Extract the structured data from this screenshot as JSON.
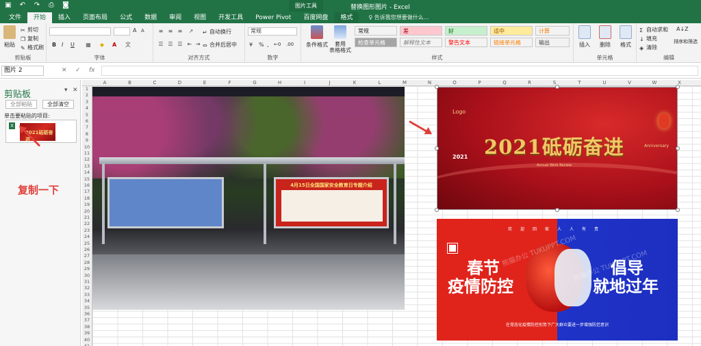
{
  "window": {
    "title": "替换图形图片 - Excel",
    "context_group": "图片工具",
    "qat_icons": [
      "save-icon",
      "undo-icon",
      "redo-icon",
      "print-preview-icon",
      "screenshot-icon"
    ]
  },
  "tabs": [
    "文件",
    "开始",
    "插入",
    "页面布局",
    "公式",
    "数据",
    "审阅",
    "视图",
    "开发工具",
    "Power Pivot",
    "百度网盘",
    "格式"
  ],
  "active_tab": "开始",
  "tell_me": "告诉我您想要做什么...",
  "ribbon": {
    "clipboard": {
      "label": "剪贴板",
      "paste": "粘贴",
      "cut": "剪切",
      "copy": "复制",
      "format_painter": "格式刷"
    },
    "font": {
      "label": "字体",
      "bold": "B",
      "italic": "I",
      "underline": "U",
      "grow": "A",
      "shrink": "A",
      "color_letter": "A"
    },
    "alignment": {
      "label": "对齐方式",
      "wrap": "自动换行",
      "merge": "合并后居中"
    },
    "number": {
      "label": "数字",
      "format": "常规",
      "pct": "%",
      "comma": ",",
      "inc": "←0",
      "dec": ".00"
    },
    "styles": {
      "label": "样式",
      "conditional": "条件格式",
      "table": "套用\n表格格式",
      "cells": [
        {
          "text": "常规",
          "bg": "#ffffff",
          "color": "#222222"
        },
        {
          "text": "差",
          "bg": "#ffc7ce",
          "color": "#9c0006"
        },
        {
          "text": "好",
          "bg": "#c6efce",
          "color": "#006100"
        },
        {
          "text": "适中",
          "bg": "#ffeb9c",
          "color": "#9c5700"
        },
        {
          "text": "计算",
          "bg": "#f2f2f2",
          "color": "#fa7d00"
        },
        {
          "text": "检查单元格",
          "bg": "#a5a5a5",
          "color": "#ffffff"
        },
        {
          "text": "解释性文本",
          "bg": "#ffffff",
          "color": "#7f7f7f"
        },
        {
          "text": "警告文本",
          "bg": "#ffffff",
          "color": "#ff0000"
        },
        {
          "text": "链接单元格",
          "bg": "#ffffff",
          "color": "#fa7d00"
        },
        {
          "text": "输出",
          "bg": "#f2f2f2",
          "color": "#3f3f3f"
        }
      ]
    },
    "cells": {
      "label": "单元格",
      "insert": "插入",
      "delete": "删除",
      "format": "格式"
    },
    "editing": {
      "label": "编辑",
      "autosum": "自动求和",
      "fill": "填充",
      "clear": "清除",
      "sort": "排序和筛选"
    }
  },
  "formula_bar": {
    "name_box": "图片 2",
    "cancel": "✕",
    "enter": "✓",
    "fx": "fx",
    "value": ""
  },
  "clipboard_pane": {
    "title": "剪贴板",
    "paste_all": "全部粘贴",
    "clear_all": "全部清空",
    "hint": "单击要粘贴的项目:",
    "item_thumb_text": "2021砥砺奋进",
    "xl_icon": "X"
  },
  "annotation": "复制一下",
  "columns": [
    "A",
    "B",
    "C",
    "D",
    "E",
    "F",
    "G",
    "H",
    "I",
    "J",
    "K",
    "L",
    "M",
    "N",
    "O",
    "P",
    "Q",
    "R",
    "S",
    "T",
    "U",
    "V",
    "W",
    "X"
  ],
  "rows": [
    "1",
    "2",
    "3",
    "4",
    "5",
    "6",
    "7",
    "8",
    "9",
    "10",
    "11",
    "12",
    "13",
    "14",
    "15",
    "16",
    "17",
    "18",
    "19",
    "20",
    "21",
    "22",
    "23",
    "24",
    "25",
    "26",
    "27",
    "28",
    "29",
    "30",
    "31",
    "32",
    "33",
    "34",
    "35",
    "36",
    "37",
    "38",
    "39",
    "40",
    "41",
    "42"
  ],
  "pictures": {
    "street": {
      "panel_title": "4月15日全国国家安全教育日专题介绍"
    },
    "red": {
      "logo": "Logo",
      "year": "2021",
      "slogan": "2021砥砺奋进",
      "anniversary": "Anniversary",
      "subtitle": "Annual Work Review"
    },
    "blue": {
      "top_row": "欢迎回家人人有责",
      "left1": "春节",
      "left2": "疫情防控",
      "right1": "倡导",
      "right2": "就地过年",
      "footer": "在常态化疫情防控形势下广大群众要进一步增强防范意识",
      "watermark": "熊猫办公 TUKUPPT.COM"
    }
  }
}
